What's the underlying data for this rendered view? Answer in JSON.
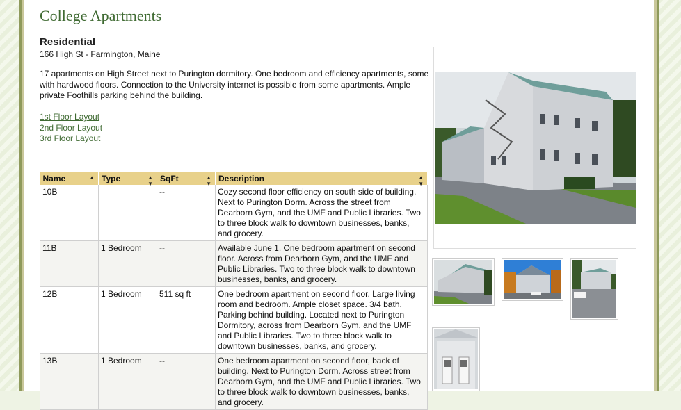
{
  "page": {
    "title": "College Apartments",
    "subhead": "Residential",
    "address": "166 High St - Farmington, Maine",
    "description": "17 apartments on High Street next to Purington dormitory. One bedroom and efficiency apartments, some with hardwood floors. Connection to the University internet  is possible from some apartments. Ample private Foothills parking behind the building."
  },
  "layouts": [
    {
      "label": "1st Floor Layout"
    },
    {
      "label": "2nd Floor Layout"
    },
    {
      "label": "3rd Floor Layout"
    }
  ],
  "table": {
    "headers": [
      "Name",
      "Type",
      "SqFt",
      "Description"
    ],
    "rows": [
      {
        "name": "10B",
        "type": "",
        "sqft": "--",
        "description": "Cozy second floor efficiency on south side of building.  Next to Purington Dorm. Across the street from Dearborn Gym, and the UMF and Public Libraries. Two to three block walk to downtown businesses, banks, and grocery."
      },
      {
        "name": "11B",
        "type": "1 Bedroom",
        "sqft": "--",
        "description": "Available June 1.  One bedroom apartment on second floor. Across from Dearborn Gym, and the UMF and Public Libraries. Two to three block walk to downtown businesses, banks, and grocery."
      },
      {
        "name": "12B",
        "type": "1 Bedroom",
        "sqft": "511 sq ft",
        "description": "One bedroom apartment on second floor. Large living room and bedroom. Ample closet space. 3/4 bath. Parking behind building.  Located next to Purington Dormitory, across from Dearborn Gym, and the UMF and Public Libraries. Two to three block walk to downtown businesses, banks, and grocery."
      },
      {
        "name": "13B",
        "type": "1 Bedroom",
        "sqft": "--",
        "description": "One bedroom apartment on second floor, back of building. Next to Purington Dorm.  Across street from Dearborn Gym, and the UMF and Public Libraries. Two to three block walk to downtown businesses, banks, and grocery."
      }
    ]
  },
  "colors": {
    "accent": "#3f6a32",
    "header_bg": "#e8d18a",
    "frame": "#8f9a5c"
  }
}
